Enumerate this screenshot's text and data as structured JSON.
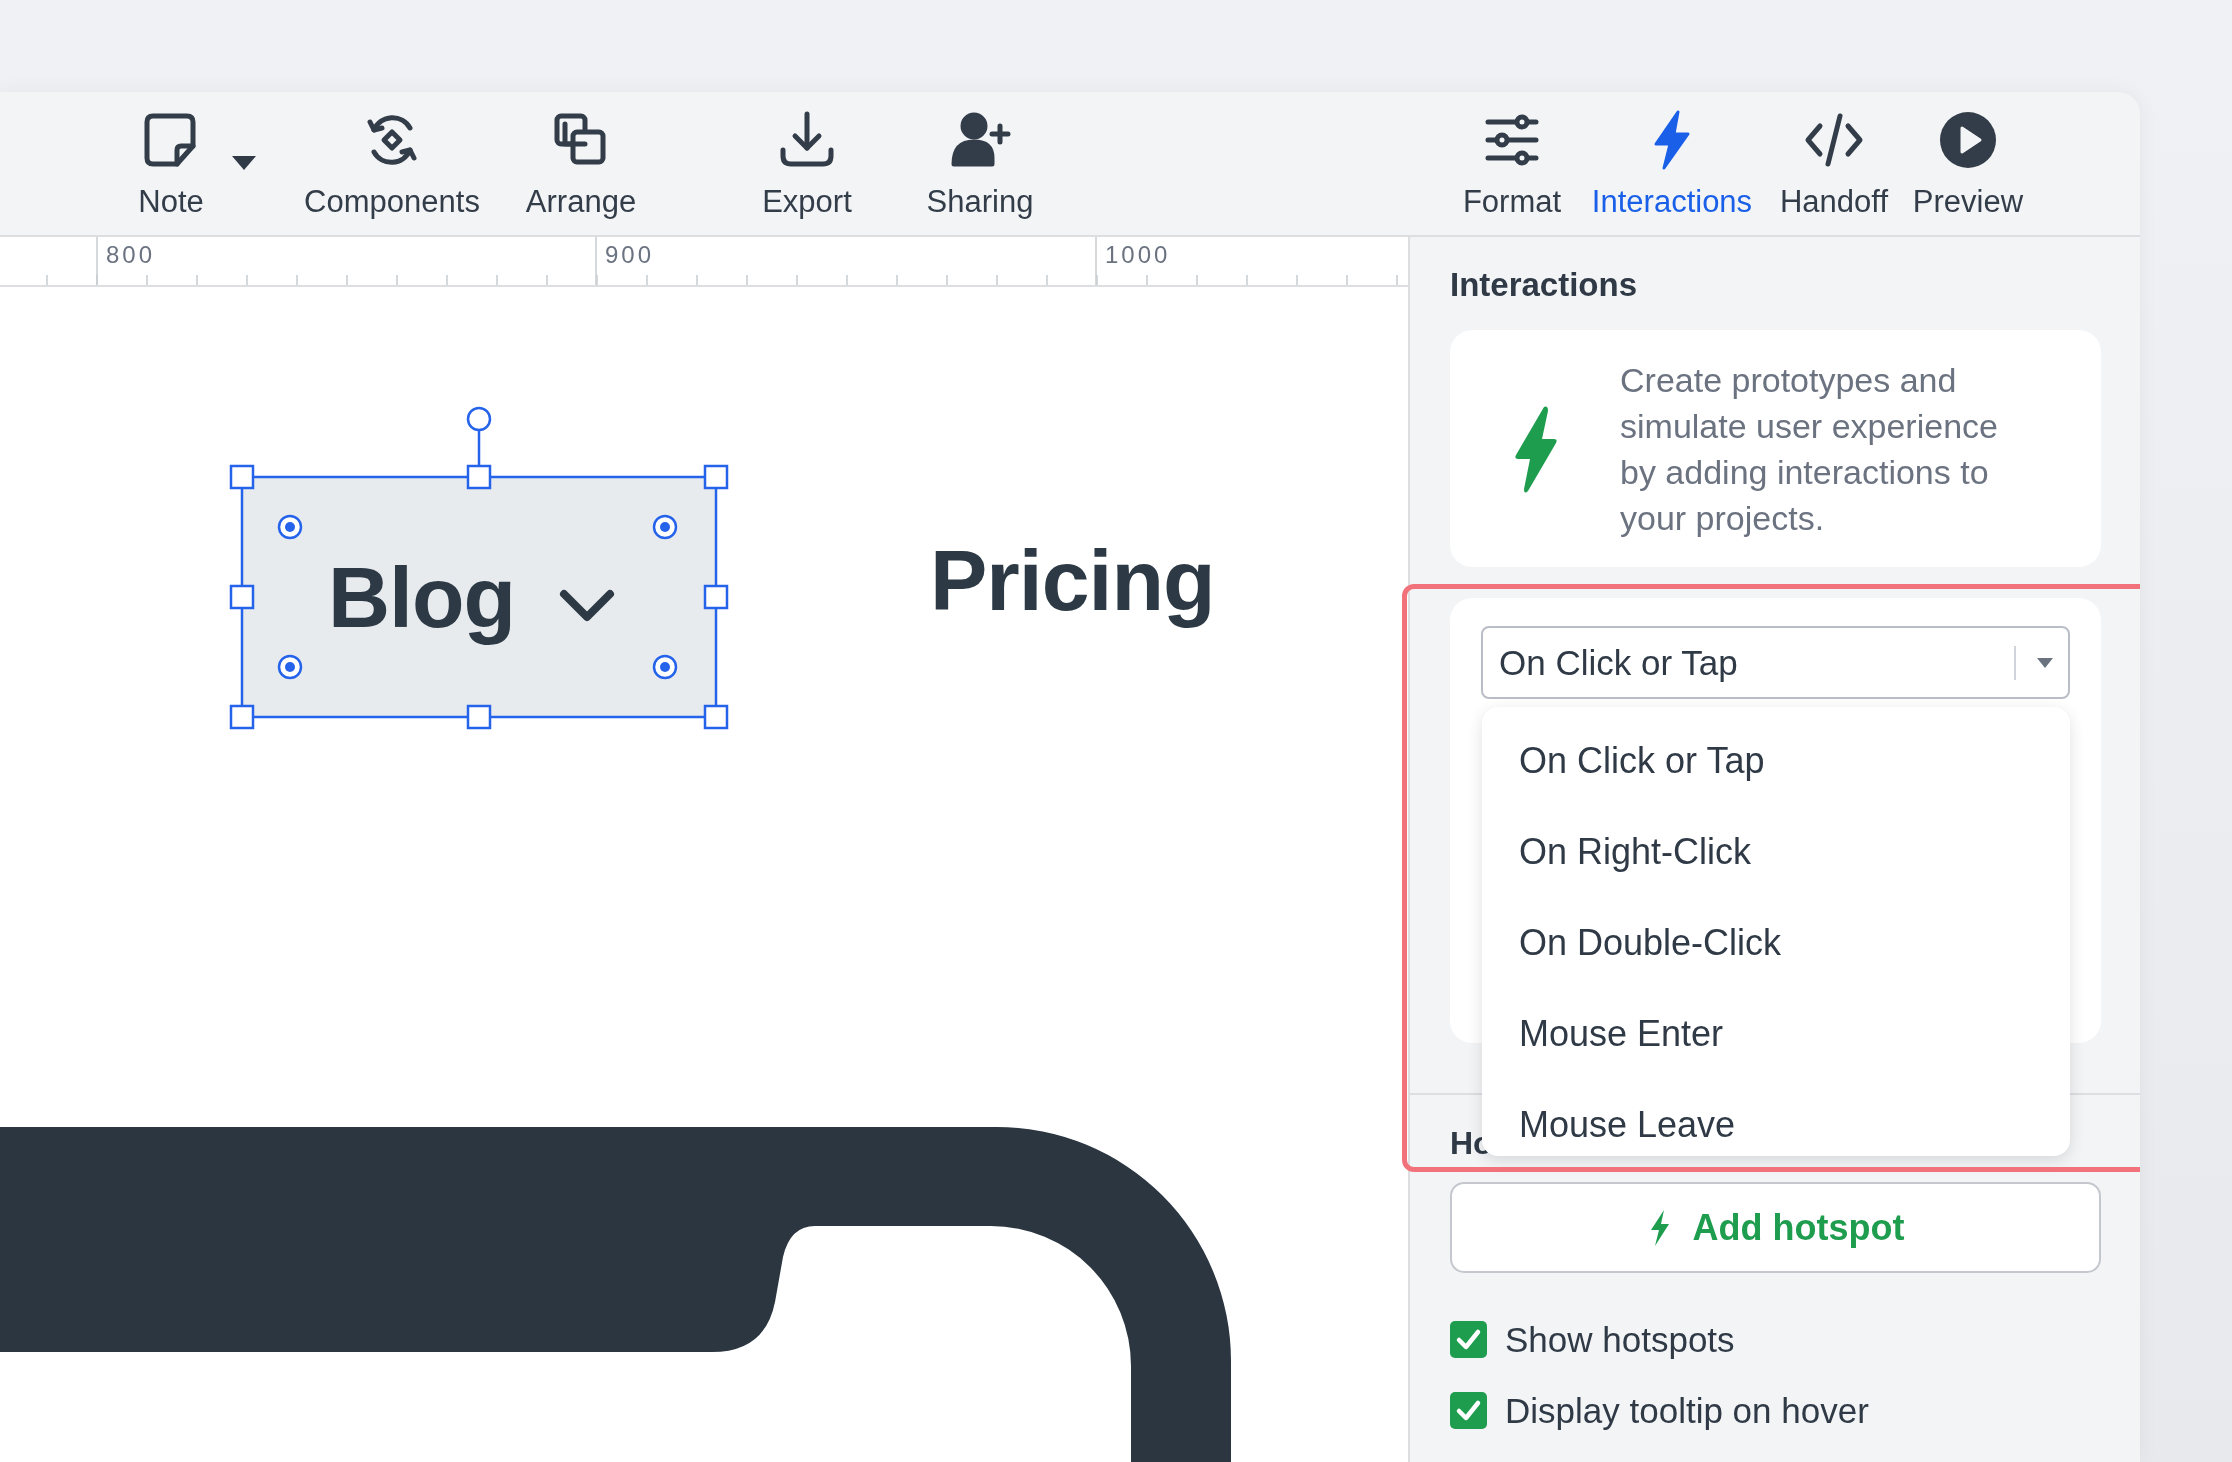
{
  "toolbar": {
    "items": [
      {
        "label": "Note",
        "selected": false
      },
      {
        "label": "Components",
        "selected": false
      },
      {
        "label": "Arrange",
        "selected": false
      },
      {
        "label": "Export",
        "selected": false
      },
      {
        "label": "Sharing",
        "selected": false
      },
      {
        "label": "Format",
        "selected": false
      },
      {
        "label": "Interactions",
        "selected": true
      },
      {
        "label": "Handoff",
        "selected": false
      },
      {
        "label": "Preview",
        "selected": false
      }
    ]
  },
  "ruler": {
    "labels": [
      "800",
      "900",
      "1000"
    ]
  },
  "canvas": {
    "elements": [
      {
        "kind": "menu-link",
        "text": "Blog",
        "selected": true
      },
      {
        "kind": "text",
        "text": "Pricing",
        "selected": false
      }
    ]
  },
  "panel": {
    "title": "Interactions",
    "info": "Create prototypes and simulate user experience by adding interactions to your projects.",
    "trigger": {
      "value": "On Click or Tap",
      "expanded": true,
      "options": [
        "On Click or Tap",
        "On Right-Click",
        "On Double-Click",
        "Mouse Enter",
        "Mouse Leave"
      ]
    },
    "hotspots": {
      "title": "Ho",
      "button": "Add hotspot",
      "options": [
        {
          "label": "Show hotspots",
          "checked": true
        },
        {
          "label": "Display tooltip on hover",
          "checked": true
        }
      ]
    }
  }
}
